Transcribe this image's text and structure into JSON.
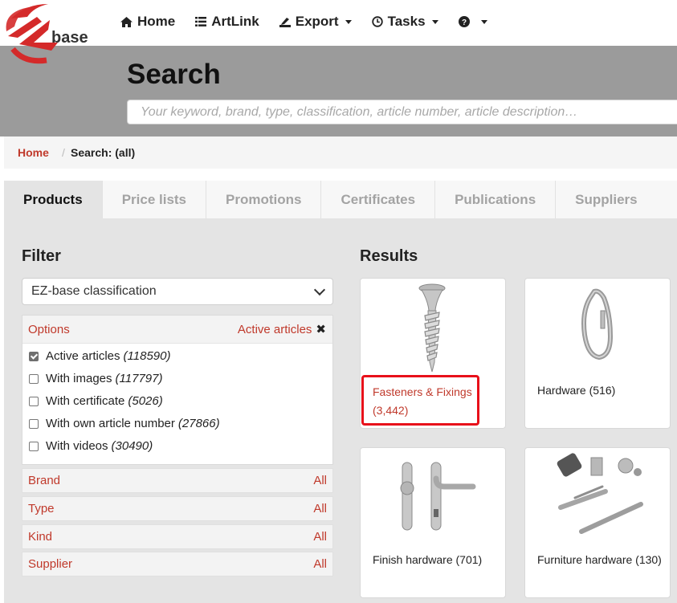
{
  "nav": {
    "logo_text": "base",
    "home": "Home",
    "artlink": "ArtLink",
    "export": "Export",
    "tasks": "Tasks"
  },
  "search": {
    "title": "Search",
    "placeholder": "Your keyword, brand, type, classification, article number, article description…"
  },
  "breadcrumb": {
    "home": "Home",
    "separator": "/",
    "current": "Search: (all)"
  },
  "tabs": [
    "Products",
    "Price lists",
    "Promotions",
    "Certificates",
    "Publications",
    "Suppliers"
  ],
  "filter": {
    "title": "Filter",
    "classification_select": "EZ-base classification",
    "options_label": "Options",
    "active_link": "Active articles",
    "options": [
      {
        "label": "Active articles",
        "count": "(118590)",
        "checked": true
      },
      {
        "label": "With images",
        "count": "(117797)",
        "checked": false
      },
      {
        "label": "With certificate",
        "count": "(5026)",
        "checked": false
      },
      {
        "label": "With own article number",
        "count": "(27866)",
        "checked": false
      },
      {
        "label": "With videos",
        "count": "(30490)",
        "checked": false
      }
    ],
    "facets": [
      {
        "label": "Brand",
        "value": "All"
      },
      {
        "label": "Type",
        "value": "All"
      },
      {
        "label": "Kind",
        "value": "All"
      },
      {
        "label": "Supplier",
        "value": "All"
      }
    ]
  },
  "results": {
    "title": "Results",
    "items": [
      {
        "label": "Fasteners & Fixings",
        "count": "(3,442)"
      },
      {
        "label": "Hardware (516)"
      },
      {
        "label": "Finish hardware (701)"
      },
      {
        "label": "Furniture hardware (130)"
      }
    ]
  },
  "colors": {
    "accent": "#c0392b",
    "banner": "#9b9b9b",
    "highlight": "#e8101a",
    "logo_red": "#d42a2a"
  }
}
